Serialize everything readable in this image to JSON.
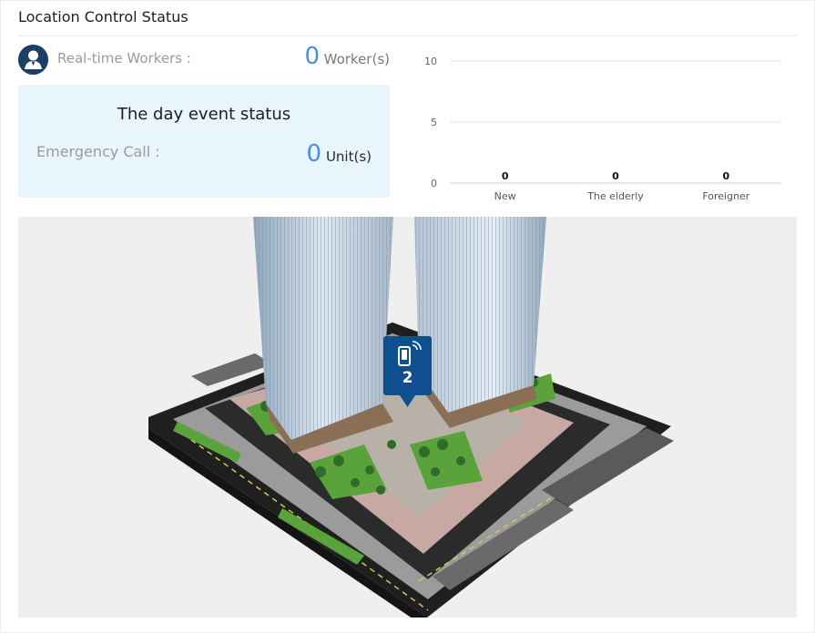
{
  "panel": {
    "title": "Location Control Status"
  },
  "workers": {
    "label": "Real-time Workers :",
    "count": "0",
    "unit": "Worker(s)",
    "icon": "worker-avatar-icon"
  },
  "event_status": {
    "title": "The day event status",
    "emergency_label": "Emergency Call :",
    "emergency_count": "0",
    "emergency_unit": "Unit(s)"
  },
  "chart_data": {
    "type": "bar",
    "categories": [
      "New",
      "The elderly",
      "Foreigner"
    ],
    "values": [
      0,
      0,
      0
    ],
    "data_labels": [
      "0",
      "0",
      "0"
    ],
    "yticks": [
      "10",
      "5",
      "0"
    ],
    "ylim": [
      0,
      10
    ],
    "grid": true
  },
  "map": {
    "marker_count": "2",
    "marker_icon": "mobile-signal-icon"
  },
  "colors": {
    "accent": "#4a90e2",
    "avatar": "#1c3f66",
    "event_bg": "#e8f5fd",
    "marker": "#0f4f8f"
  }
}
